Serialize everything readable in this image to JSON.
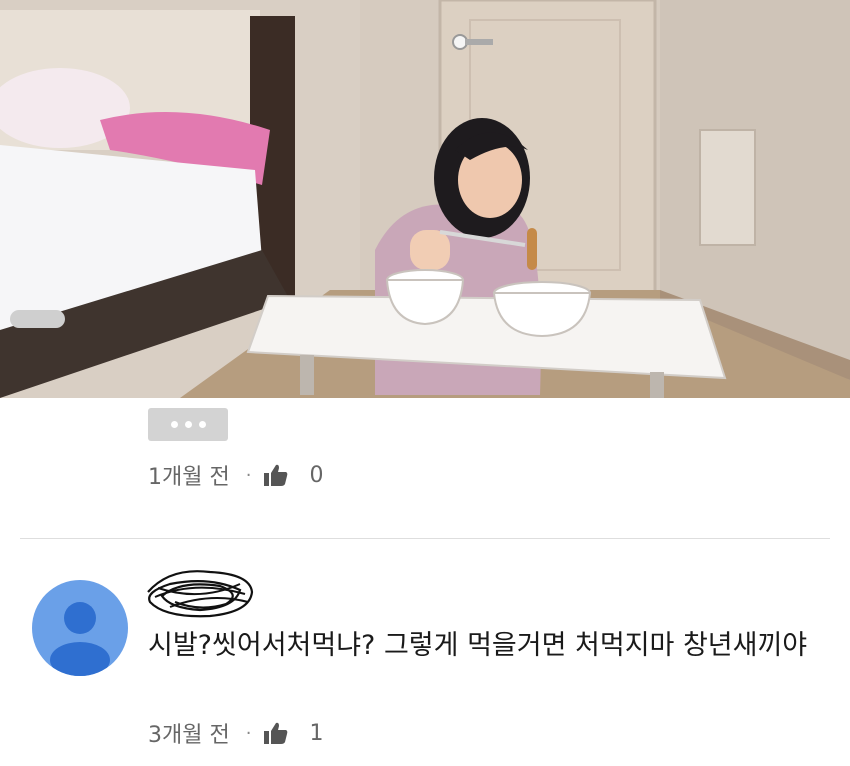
{
  "photo": {
    "description_icon": "photo"
  },
  "more_button": {
    "icon": "more-horizontal-icon"
  },
  "first_comment": {
    "time": "1개월 전",
    "separator": "·",
    "likes": "0"
  },
  "second_comment": {
    "author_redacted": true,
    "text": "시발?씻어서처먹냐? 그렇게 먹을거면 처먹지마 창년새끼야",
    "time": "3개월 전",
    "separator": "·",
    "likes": "1"
  },
  "colors": {
    "avatar_bg": "#6aa0e8",
    "avatar_fg": "#2f6fd0",
    "button_bg": "#d3d3d3"
  }
}
